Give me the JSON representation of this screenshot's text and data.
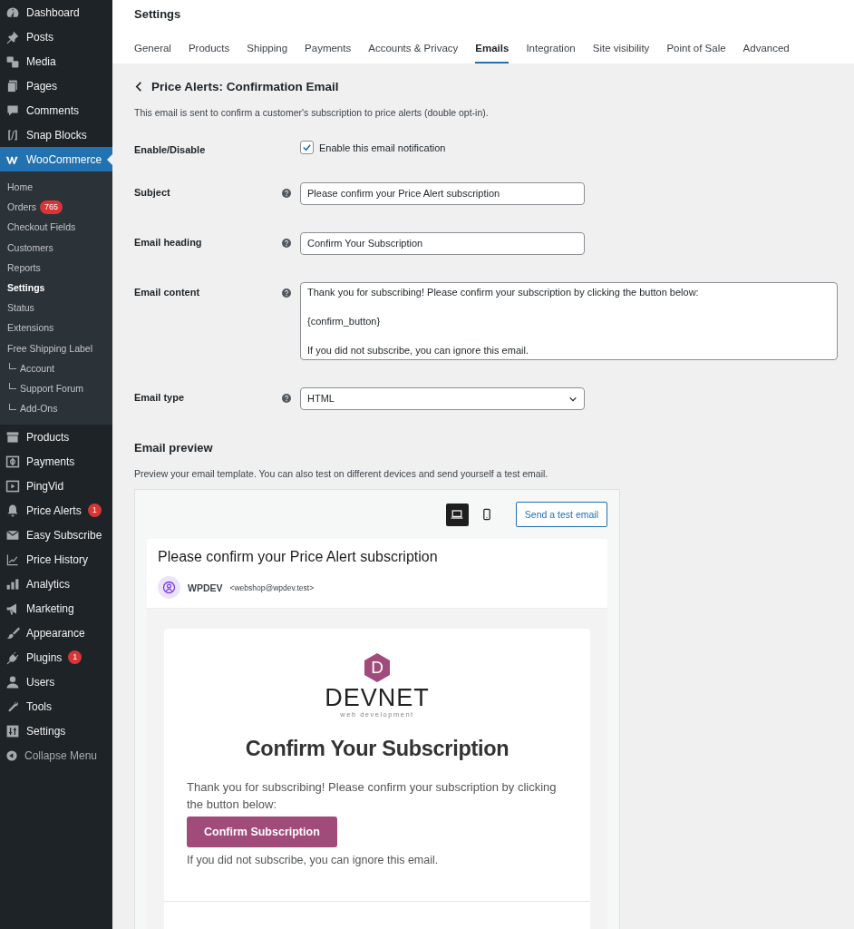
{
  "sidebar": {
    "items": [
      {
        "label": "Dashboard",
        "selected": false
      },
      {
        "label": "Posts",
        "selected": false
      },
      {
        "label": "Media",
        "selected": false
      },
      {
        "label": "Pages",
        "selected": false
      },
      {
        "label": "Comments",
        "selected": false
      },
      {
        "label": "Snap Blocks",
        "selected": false
      },
      {
        "label": "WooCommerce",
        "selected": true,
        "children": [
          {
            "label": "Home",
            "selected": false
          },
          {
            "label": "Orders",
            "badge": "765",
            "selected": false
          },
          {
            "label": "Checkout Fields",
            "selected": false
          },
          {
            "label": "Customers",
            "selected": false
          },
          {
            "label": "Reports",
            "selected": false
          },
          {
            "label": "Settings",
            "selected": true
          },
          {
            "label": "Status",
            "selected": false
          },
          {
            "label": "Extensions",
            "selected": false
          },
          {
            "label": "Free Shipping Label",
            "selected": false,
            "children": [
              {
                "label": "Account",
                "selected": false
              },
              {
                "label": "Support Forum",
                "selected": false
              },
              {
                "label": "Add-Ons",
                "selected": false
              }
            ]
          }
        ]
      },
      {
        "label": "Products",
        "selected": false
      },
      {
        "label": "Payments",
        "selected": false
      },
      {
        "label": "PingVid",
        "selected": false
      },
      {
        "label": "Price Alerts",
        "badge": "1",
        "selected": false
      },
      {
        "label": "Easy Subscribe",
        "selected": false
      },
      {
        "label": "Price History",
        "selected": false
      },
      {
        "label": "Analytics",
        "selected": false
      },
      {
        "label": "Marketing",
        "selected": false
      },
      {
        "label": "Appearance",
        "selected": false
      },
      {
        "label": "Plugins",
        "badge": "1",
        "selected": false
      },
      {
        "label": "Users",
        "selected": false
      },
      {
        "label": "Tools",
        "selected": false
      },
      {
        "label": "Settings",
        "selected": false
      }
    ],
    "collapse": "Collapse Menu"
  },
  "page": {
    "title": "Settings",
    "tabs": [
      {
        "label": "General",
        "selected": false
      },
      {
        "label": "Products",
        "selected": false
      },
      {
        "label": "Shipping",
        "selected": false
      },
      {
        "label": "Payments",
        "selected": false
      },
      {
        "label": "Accounts & Privacy",
        "selected": false
      },
      {
        "label": "Emails",
        "selected": true
      },
      {
        "label": "Integration",
        "selected": false
      },
      {
        "label": "Site visibility",
        "selected": false
      },
      {
        "label": "Point of Sale",
        "selected": false
      },
      {
        "label": "Advanced",
        "selected": false
      }
    ],
    "heading": "Price Alerts: Confirmation Email",
    "description": "This email is sent to confirm a customer's subscription to price alerts (double opt-in).",
    "fields": [
      {
        "kind": "checkbox",
        "label": "Enable/Disable",
        "text": "Enable this email notification",
        "checked": true
      },
      {
        "kind": "text",
        "label": "Subject",
        "value": "Please confirm your Price Alert subscription"
      },
      {
        "kind": "text",
        "label": "Email heading",
        "value": "Confirm Your Subscription"
      },
      {
        "kind": "textarea",
        "label": "Email content",
        "value": "Thank you for subscribing! Please confirm your subscription by clicking the button below:\n\n{confirm_button}\n\nIf you did not subscribe, you can ignore this email."
      },
      {
        "kind": "select",
        "label": "Email type",
        "value": "HTML"
      }
    ]
  },
  "preview": {
    "title": "Email preview",
    "description": "Preview your email template. You can also test on different devices and send yourself a test email.",
    "devices": [
      {
        "kind": "desktop",
        "selected": true
      },
      {
        "kind": "mobile",
        "selected": false
      }
    ],
    "send_button": "Send a test email",
    "email": {
      "subject": "Please confirm your Price Alert subscription",
      "sender_name": "WPDEV",
      "sender_address": "<webshop@wpdev.test>",
      "logo": {
        "letter": "D",
        "name": "DEVNET",
        "tagline": "web development"
      },
      "heading": "Confirm Your Subscription",
      "body": "Thank you for subscribing! Please confirm your subscription by clicking the button below:",
      "button": "Confirm Subscription",
      "footer": "If you did not subscribe, you can ignore this email."
    }
  }
}
